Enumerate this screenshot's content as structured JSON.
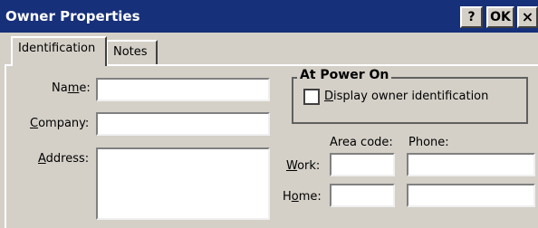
{
  "window": {
    "title": "Owner Properties",
    "help_label": "?",
    "ok_label": "OK",
    "close_label": "×"
  },
  "tabs": [
    {
      "label": "Identification",
      "active": true
    },
    {
      "label": "Notes",
      "active": false
    }
  ],
  "identification": {
    "name_label_pre": "Na",
    "name_label_hot": "m",
    "name_label_post": "e:",
    "company_label_hot": "C",
    "company_label_post": "ompany:",
    "address_label_hot": "A",
    "address_label_post": "ddress:",
    "name_value": "",
    "company_value": "",
    "address_value": ""
  },
  "power_on": {
    "group_title": "At Power On",
    "checkbox_label_hot": "D",
    "checkbox_label_post": "isplay owner identification",
    "checked": false
  },
  "phones": {
    "area_code_header": "Area code:",
    "phone_header": "Phone:",
    "work_label_hot": "W",
    "work_label_post": "ork:",
    "home_label_pre": "H",
    "home_label_hot": "o",
    "home_label_post": "me:",
    "work_area": "",
    "work_phone": "",
    "home_area": "",
    "home_phone": ""
  },
  "colors": {
    "title_bar": "#17307a",
    "face": "#d4d0c8"
  }
}
